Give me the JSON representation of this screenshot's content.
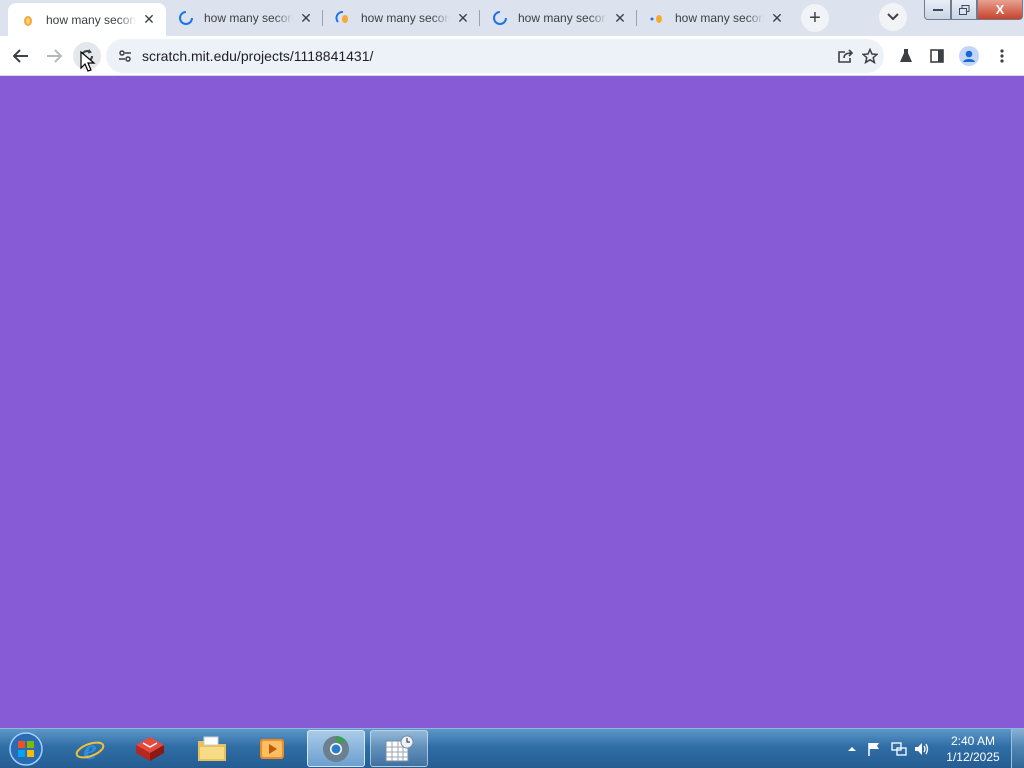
{
  "browser": {
    "tabs": [
      {
        "title": "how many seconds",
        "favicon": "scratch-cat-icon",
        "active": true
      },
      {
        "title": "how many seconds",
        "favicon": "google-loading-icon",
        "active": false
      },
      {
        "title": "how many seconds",
        "favicon": "scratch-loading-icon",
        "active": false
      },
      {
        "title": "how many seconds",
        "favicon": "google-loading-icon",
        "active": false
      },
      {
        "title": "how many seconds",
        "favicon": "scratch-cat-icon",
        "active": false
      }
    ],
    "close_glyph": "✕",
    "new_tab_glyph": "+",
    "address_url": "scratch.mit.edu/projects/1118841431/",
    "page_background": "#875ad6"
  },
  "window_controls": {
    "close_glyph": "X"
  },
  "taskbar": {
    "apps": [
      "start-orb",
      "internet-explorer",
      "app-red-cube",
      "file-explorer",
      "media-player",
      "chrome",
      "calendar-app"
    ],
    "clock_time": "2:40 AM",
    "clock_date": "1/12/2025"
  }
}
